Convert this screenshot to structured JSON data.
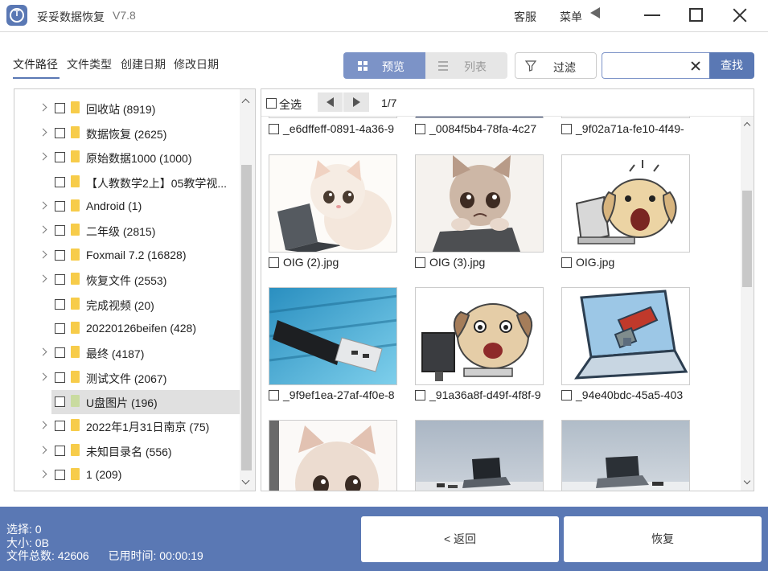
{
  "app": {
    "title": "妥妥数据恢复",
    "version": "V7.8",
    "support": "客服",
    "menu": "菜单"
  },
  "path_tabs": [
    "文件路径",
    "文件类型",
    "创建日期",
    "修改日期"
  ],
  "view_toggle": {
    "preview": "预览",
    "list": "列表"
  },
  "filter_label": "过滤",
  "search": {
    "value": "",
    "button": "查找"
  },
  "tree": [
    {
      "label": "回收站  (8919)",
      "expandable": true
    },
    {
      "label": "数据恢复  (2625)",
      "expandable": true
    },
    {
      "label": "原始数据1000  (1000)",
      "expandable": true
    },
    {
      "label": "【人教数学2上】05教学视...",
      "expandable": false
    },
    {
      "label": "Android  (1)",
      "expandable": true
    },
    {
      "label": "二年级  (2815)",
      "expandable": true
    },
    {
      "label": "Foxmail 7.2  (16828)",
      "expandable": true
    },
    {
      "label": "恢复文件  (2553)",
      "expandable": true
    },
    {
      "label": "完成视频  (20)",
      "expandable": false
    },
    {
      "label": "20220126beifen  (428)",
      "expandable": false
    },
    {
      "label": "最终  (4187)",
      "expandable": true
    },
    {
      "label": "测试文件  (2067)",
      "expandable": true
    },
    {
      "label": "U盘图片  (196)",
      "expandable": false,
      "selected": true
    },
    {
      "label": "2022年1月31日南京  (75)",
      "expandable": true
    },
    {
      "label": "未知目录名  (556)",
      "expandable": true
    },
    {
      "label": "1  (209)",
      "expandable": true
    }
  ],
  "grid": {
    "select_all": "全选",
    "page": "1/7",
    "top_row_names": [
      "_e6dffeff-0891-4a36-9",
      "_0084f5b4-78fa-4c27",
      "_9f02a71a-fe10-4f49-"
    ],
    "files": [
      {
        "name": "OIG (2).jpg",
        "image": "kitten-laptop"
      },
      {
        "name": "OIG (3).jpg",
        "image": "sad-kitten-laptop"
      },
      {
        "name": "OIG.jpg",
        "image": "dog-laptop"
      },
      {
        "name": "_9f9ef1ea-27af-4f0e-8",
        "image": "usb-drive"
      },
      {
        "name": "_91a36a8f-d49f-4f8f-9",
        "image": "pug-computer"
      },
      {
        "name": "_94e40bdc-45a5-403",
        "image": "usb-on-laptop"
      },
      {
        "name": "",
        "image": "kitten-closeup"
      },
      {
        "name": "",
        "image": "laptop-desk"
      },
      {
        "name": "",
        "image": "laptop-desk-2"
      }
    ]
  },
  "status": {
    "selected_label": "选择:",
    "selected_value": "0",
    "size_label": "大小:",
    "size_value": "0B",
    "total_label": "文件总数:",
    "total_value": "42606",
    "elapsed_label": "已用时间:",
    "elapsed_value": "00:00:19"
  },
  "buttons": {
    "back": "< 返回",
    "recover": "恢复"
  },
  "colors": {
    "accent": "#5a78b4",
    "toggle_active": "#7c93c7"
  }
}
